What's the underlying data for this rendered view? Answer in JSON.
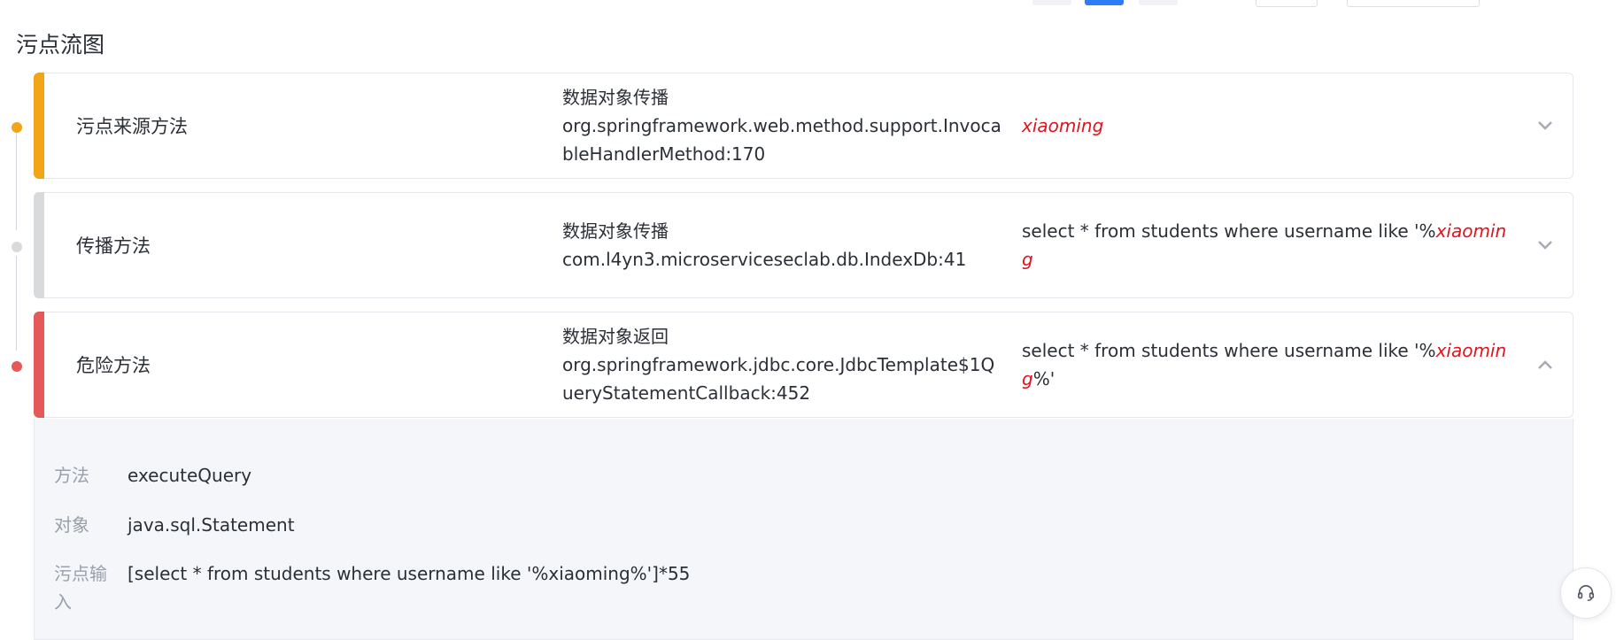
{
  "section": {
    "title": "污点流图"
  },
  "nodes": [
    {
      "type_label": "污点来源方法",
      "prop_title": "数据对象传播",
      "prop_location": "org.springframework.web.method.support.InvocableHandlerMethod:170",
      "value_plain": "",
      "value_taint": "xiaoming",
      "value_suffix": "",
      "bar_color": "#f2a516",
      "expanded": false
    },
    {
      "type_label": "传播方法",
      "prop_title": "数据对象传播",
      "prop_location": "com.l4yn3.microserviceseclab.db.IndexDb:41",
      "value_plain": "select * from students where username like '%",
      "value_taint": "xiaoming",
      "value_suffix": "",
      "bar_color": "#d9dadc",
      "expanded": false
    },
    {
      "type_label": "危险方法",
      "prop_title": "数据对象返回",
      "prop_location": "org.springframework.jdbc.core.JdbcTemplate$1QueryStatementCallback:452",
      "value_plain": "select * from students where username like '%",
      "value_taint": "xiaoming",
      "value_suffix": "%'",
      "bar_color": "#e45a5a",
      "expanded": true
    }
  ],
  "detail": {
    "method_label": "方法",
    "method_value": "executeQuery",
    "object_label": "对象",
    "object_value": "java.sql.Statement",
    "input_label": "污点输入",
    "input_value": "[select * from students where username like '%xiaoming%']*55"
  },
  "colors": {
    "timeline_dot_1": "#f2a516",
    "timeline_dot_2": "#d9dadc",
    "timeline_dot_3": "#e45a5a",
    "taint_text": "#e0141e",
    "primary": "#2f7cf6"
  },
  "icons": {
    "collapsed": "chevron-down-icon",
    "expanded": "chevron-up-icon",
    "help": "headset-icon"
  }
}
